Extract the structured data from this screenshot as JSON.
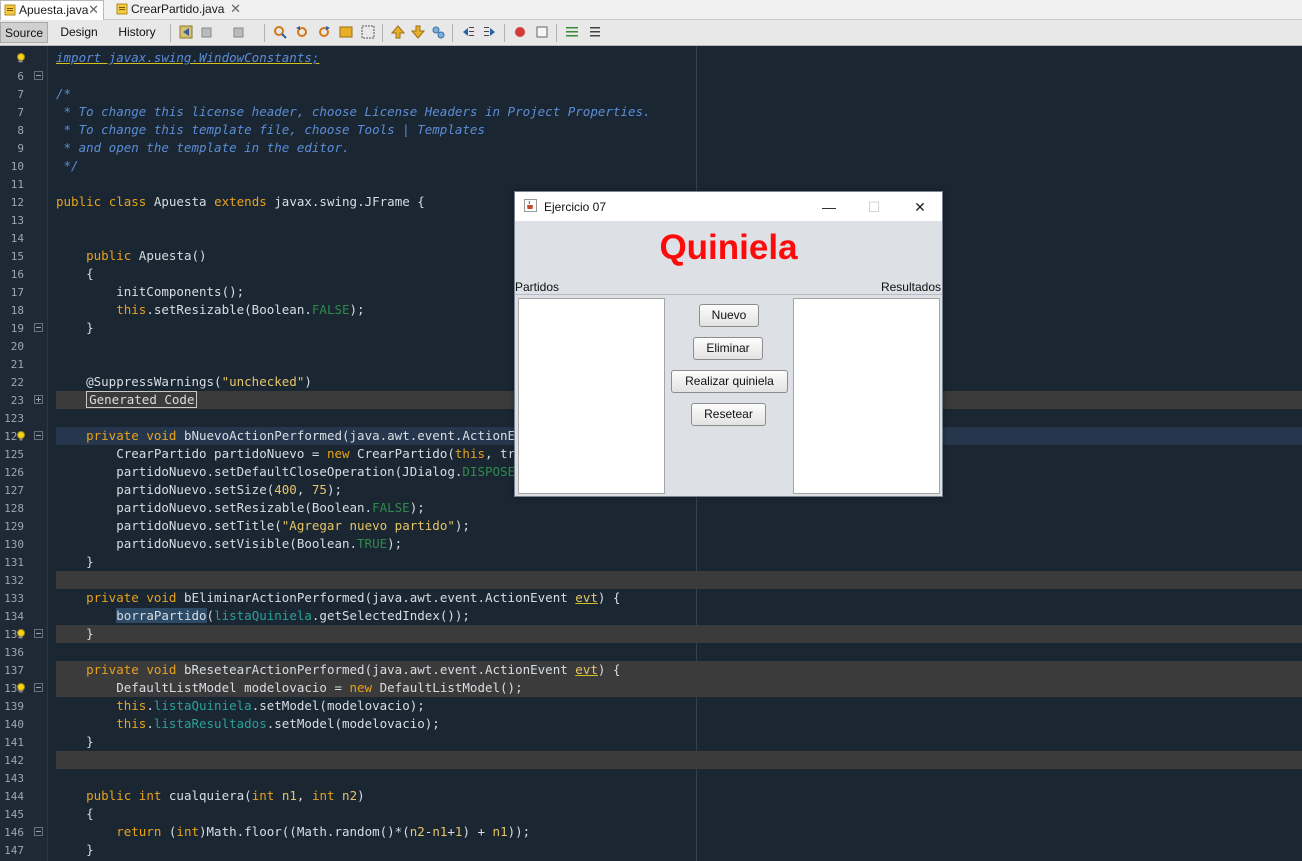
{
  "tabs": [
    {
      "label": "Apuesta.java",
      "active": true
    },
    {
      "label": "CrearPartido.java",
      "active": false
    }
  ],
  "toolbar": {
    "views": [
      "Source",
      "Design",
      "History"
    ],
    "active_view": "Source"
  },
  "editor": {
    "lines": [
      {
        "n": "5",
        "parts": [
          [
            "import javax.swing.WindowConstants;",
            "cm warn"
          ]
        ]
      },
      {
        "n": "6",
        "parts": [
          [
            "",
            ""
          ]
        ]
      },
      {
        "n": "7",
        "parts": [
          [
            "/*",
            "cm"
          ]
        ]
      },
      {
        "n": "7",
        "parts": [
          [
            " * To change this license header, choose License Headers in Project Properties.",
            "cm"
          ]
        ]
      },
      {
        "n": "8",
        "parts": [
          [
            " * To change this template file, choose Tools | Templates",
            "cm"
          ]
        ]
      },
      {
        "n": "9",
        "parts": [
          [
            " * and open the template in the editor.",
            "cm"
          ]
        ]
      },
      {
        "n": "10",
        "parts": [
          [
            " */",
            "cm"
          ]
        ]
      },
      {
        "n": "11",
        "parts": [
          [
            "",
            ""
          ]
        ]
      },
      {
        "n": "12",
        "parts": [
          [
            "public ",
            "kw"
          ],
          [
            "class ",
            "kw"
          ],
          [
            "Apuesta ",
            "plain"
          ],
          [
            "extends ",
            "kw"
          ],
          [
            "javax.swing.JFrame {",
            "plain"
          ]
        ]
      },
      {
        "n": "13",
        "parts": [
          [
            "",
            ""
          ]
        ]
      },
      {
        "n": "14",
        "parts": [
          [
            "",
            ""
          ]
        ]
      },
      {
        "n": "15",
        "parts": [
          [
            "    public ",
            "kw"
          ],
          [
            "Apuesta()",
            "plain"
          ]
        ]
      },
      {
        "n": "16",
        "parts": [
          [
            "    {",
            "plain"
          ]
        ]
      },
      {
        "n": "17",
        "parts": [
          [
            "        initComponents();",
            "plain"
          ]
        ]
      },
      {
        "n": "18",
        "parts": [
          [
            "        this",
            "kw"
          ],
          [
            ".setResizable(Boolean.",
            "plain"
          ],
          [
            "FALSE",
            "gr"
          ],
          [
            ");",
            "plain"
          ]
        ]
      },
      {
        "n": "19",
        "parts": [
          [
            "    }",
            "plain"
          ]
        ]
      },
      {
        "n": "20",
        "parts": [
          [
            "",
            ""
          ]
        ]
      },
      {
        "n": "21",
        "parts": [
          [
            "",
            ""
          ]
        ]
      },
      {
        "n": "22",
        "parts": [
          [
            "    @SuppressWarnings(",
            "plain"
          ],
          [
            "\"unchecked\"",
            "st"
          ],
          [
            ")",
            "plain"
          ]
        ]
      },
      {
        "n": "23",
        "parts": [
          [
            "    ",
            "plain"
          ],
          [
            "Generated Code",
            "foldbox"
          ]
        ]
      },
      {
        "n": "123",
        "parts": [
          [
            "",
            ""
          ]
        ]
      },
      {
        "n": "124",
        "parts": [
          [
            "    private ",
            "kw"
          ],
          [
            "void ",
            "kw"
          ],
          [
            "bNuevoActionPerformed(java.awt.event.ActionEvent evt) {",
            "plain"
          ]
        ]
      },
      {
        "n": "125",
        "parts": [
          [
            "        CrearPartido partidoNuevo = ",
            "plain"
          ],
          [
            "new ",
            "kw"
          ],
          [
            "CrearPartido(",
            "plain"
          ],
          [
            "this",
            "kw"
          ],
          [
            ", true);",
            "plain"
          ]
        ]
      },
      {
        "n": "126",
        "parts": [
          [
            "        partidoNuevo.setDefaultCloseOperation(JDialog.",
            "plain"
          ],
          [
            "DISPOSE_ON_CLOSE",
            "gr"
          ],
          [
            ");",
            "plain"
          ]
        ]
      },
      {
        "n": "127",
        "parts": [
          [
            "        partidoNuevo.setSize(",
            "plain"
          ],
          [
            "400",
            "st"
          ],
          [
            ", ",
            "plain"
          ],
          [
            "75",
            "st"
          ],
          [
            ");",
            "plain"
          ]
        ]
      },
      {
        "n": "128",
        "parts": [
          [
            "        partidoNuevo.setResizable(Boolean.",
            "plain"
          ],
          [
            "FALSE",
            "gr"
          ],
          [
            ");",
            "plain"
          ]
        ]
      },
      {
        "n": "129",
        "parts": [
          [
            "        partidoNuevo.setTitle(",
            "plain"
          ],
          [
            "\"Agregar nuevo partido\"",
            "st"
          ],
          [
            ");",
            "plain"
          ]
        ]
      },
      {
        "n": "130",
        "parts": [
          [
            "        partidoNuevo.setVisible(Boolean.",
            "plain"
          ],
          [
            "TRUE",
            "gr"
          ],
          [
            ");",
            "plain"
          ]
        ]
      },
      {
        "n": "131",
        "parts": [
          [
            "    }",
            "plain"
          ]
        ]
      },
      {
        "n": "132",
        "parts": [
          [
            "",
            ""
          ]
        ]
      },
      {
        "n": "133",
        "parts": [
          [
            "    private ",
            "kw"
          ],
          [
            "void ",
            "kw"
          ],
          [
            "bEliminarActionPerformed(java.awt.event.ActionEvent ",
            "plain"
          ],
          [
            "evt",
            "st warn"
          ],
          [
            ") {",
            "plain"
          ]
        ]
      },
      {
        "n": "134",
        "parts": [
          [
            "        ",
            "plain"
          ],
          [
            "borraPartido",
            "selword"
          ],
          [
            "(",
            "plain"
          ],
          [
            "listaQuiniela",
            "tl"
          ],
          [
            ".getSelectedIndex());",
            "plain"
          ]
        ]
      },
      {
        "n": "135",
        "parts": [
          [
            "    }",
            "plain"
          ]
        ]
      },
      {
        "n": "136",
        "parts": [
          [
            "",
            ""
          ]
        ]
      },
      {
        "n": "137",
        "parts": [
          [
            "    private ",
            "kw"
          ],
          [
            "void ",
            "kw"
          ],
          [
            "bResetearActionPerformed(java.awt.event.ActionEvent ",
            "plain"
          ],
          [
            "evt",
            "st warn"
          ],
          [
            ") {",
            "plain"
          ]
        ]
      },
      {
        "n": "138",
        "parts": [
          [
            "        DefaultListModel modelovacio = ",
            "plain"
          ],
          [
            "new ",
            "kw"
          ],
          [
            "DefaultListModel();",
            "plain"
          ]
        ]
      },
      {
        "n": "139",
        "parts": [
          [
            "        this",
            "kw"
          ],
          [
            ".",
            "plain"
          ],
          [
            "listaQuiniela",
            "tl"
          ],
          [
            ".setModel(modelovacio);",
            "plain"
          ]
        ]
      },
      {
        "n": "140",
        "parts": [
          [
            "        this",
            "kw"
          ],
          [
            ".",
            "plain"
          ],
          [
            "listaResultados",
            "tl"
          ],
          [
            ".setModel(modelovacio);",
            "plain"
          ]
        ]
      },
      {
        "n": "141",
        "parts": [
          [
            "    }",
            "plain"
          ]
        ]
      },
      {
        "n": "142",
        "parts": [
          [
            "",
            ""
          ]
        ]
      },
      {
        "n": "143",
        "parts": [
          [
            "",
            ""
          ]
        ]
      },
      {
        "n": "144",
        "parts": [
          [
            "    public ",
            "kw"
          ],
          [
            "int ",
            "kw"
          ],
          [
            "cualquiera(",
            "plain"
          ],
          [
            "int ",
            "kw"
          ],
          [
            "n1",
            "st"
          ],
          [
            ", ",
            "plain"
          ],
          [
            "int ",
            "kw"
          ],
          [
            "n2",
            "st"
          ],
          [
            ")",
            "plain"
          ]
        ]
      },
      {
        "n": "145",
        "parts": [
          [
            "    {",
            "plain"
          ]
        ]
      },
      {
        "n": "146",
        "parts": [
          [
            "        return ",
            "kw"
          ],
          [
            "(",
            "plain"
          ],
          [
            "int",
            "kw"
          ],
          [
            ")Math.floor((Math.random()*(",
            "plain"
          ],
          [
            "n2",
            "st"
          ],
          [
            "-",
            "plain"
          ],
          [
            "n1",
            "st"
          ],
          [
            "+",
            "plain"
          ],
          [
            "1",
            "st"
          ],
          [
            ") + ",
            "plain"
          ],
          [
            "n1",
            "st"
          ],
          [
            "));",
            "plain"
          ]
        ]
      },
      {
        "n": "147",
        "parts": [
          [
            "    }",
            "plain"
          ]
        ]
      }
    ]
  },
  "dialog": {
    "title": "Ejercicio 07",
    "heading": "Quiniela",
    "label_left": "Partidos",
    "label_right": "Resultados",
    "buttons": {
      "nuevo": "Nuevo",
      "eliminar": "Eliminar",
      "realizar": "Realizar quiniela",
      "resetear": "Resetear"
    },
    "controls": {
      "minimize": "—",
      "maximize": "☐",
      "close": "✕"
    }
  }
}
